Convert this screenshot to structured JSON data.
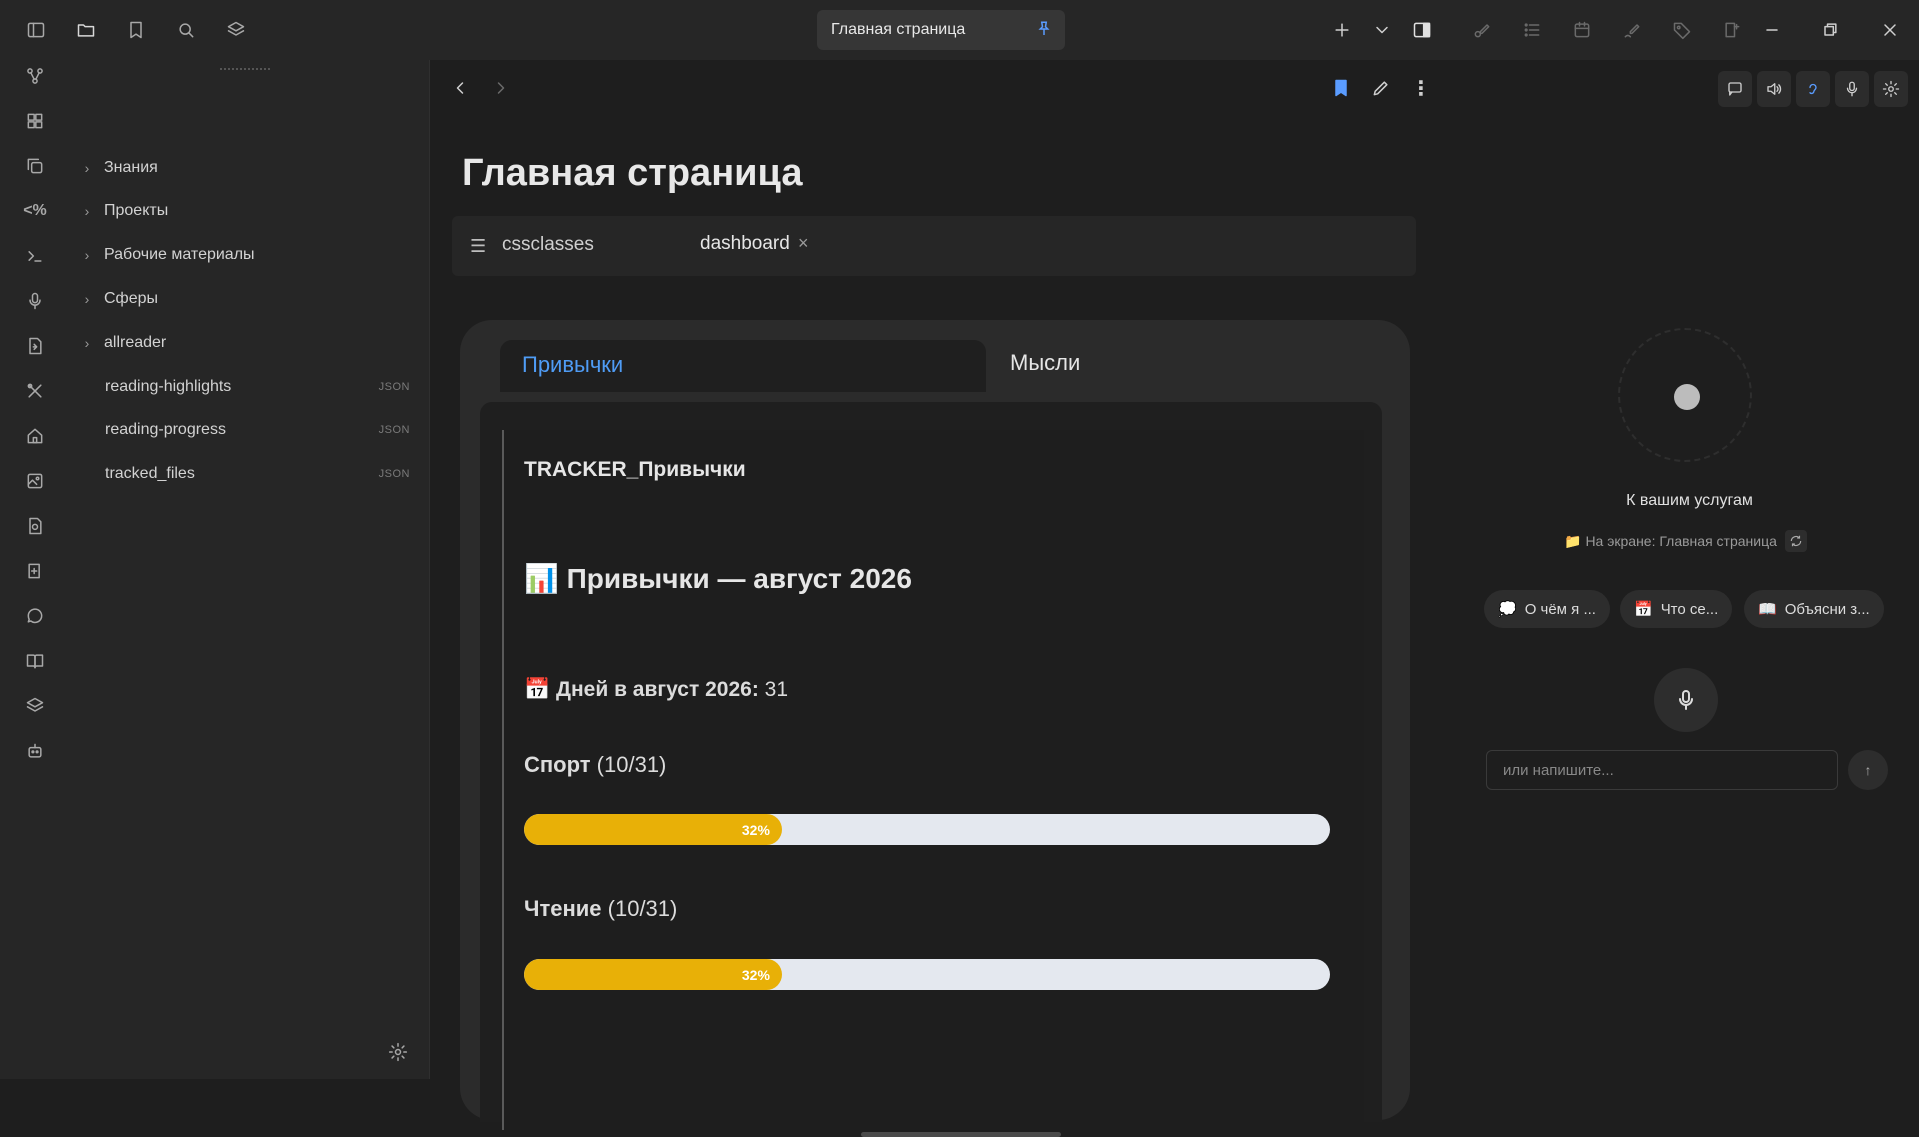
{
  "window": {
    "tab_title": "Главная страница"
  },
  "ribbon": {
    "icons": [
      "graph-icon",
      "grid-icon",
      "copy-icon",
      "code-icon",
      "terminal-icon",
      "mic-icon",
      "import-icon",
      "tools-icon",
      "home-icon",
      "image-icon",
      "file-search-icon",
      "book-plus-icon",
      "chat-icon",
      "book-open-icon",
      "layers-icon",
      "robot-icon"
    ]
  },
  "sidebar": {
    "folders": [
      {
        "label": "Знания"
      },
      {
        "label": "Проекты"
      },
      {
        "label": "Рабочие материалы"
      },
      {
        "label": "Сферы"
      },
      {
        "label": "allreader"
      }
    ],
    "files": [
      {
        "label": "reading-highlights",
        "badge": "JSON"
      },
      {
        "label": "reading-progress",
        "badge": "JSON"
      },
      {
        "label": "tracked_files",
        "badge": "JSON"
      }
    ]
  },
  "note": {
    "title": "Главная страница",
    "property_key": "cssclasses",
    "property_value": "dashboard",
    "remove_symbol": "×"
  },
  "dashboard": {
    "tabs": [
      "Привычки",
      "Мысли"
    ],
    "tracker_title": "TRACKER_Привычки",
    "heading_emoji": "📊",
    "heading": "Привычки — август 2026",
    "days_emoji": "📅",
    "days_label": "Дней в август 2026:",
    "days_value": "31",
    "habits": [
      {
        "name": "Спорт",
        "count": "(10/31)",
        "percent_label": "32%",
        "fraction": 0.32
      },
      {
        "name": "Чтение",
        "count": "(10/31)",
        "percent_label": "32%",
        "fraction": 0.32
      }
    ],
    "colors": {
      "bar_fill": "#e8b007",
      "bar_track": "#e4e8ef",
      "active_tab": "#4f9cf5"
    }
  },
  "assistant": {
    "status": "К вашим услугам",
    "on_screen_emoji": "📁",
    "on_screen": "На экране: Главная страница",
    "chips": [
      {
        "emoji": "💭",
        "label": "О чём я ..."
      },
      {
        "emoji": "📅",
        "label": "Что се..."
      },
      {
        "emoji": "📖",
        "label": "Объясни з..."
      }
    ],
    "input_placeholder": "или напишите...",
    "send_symbol": "↑"
  }
}
